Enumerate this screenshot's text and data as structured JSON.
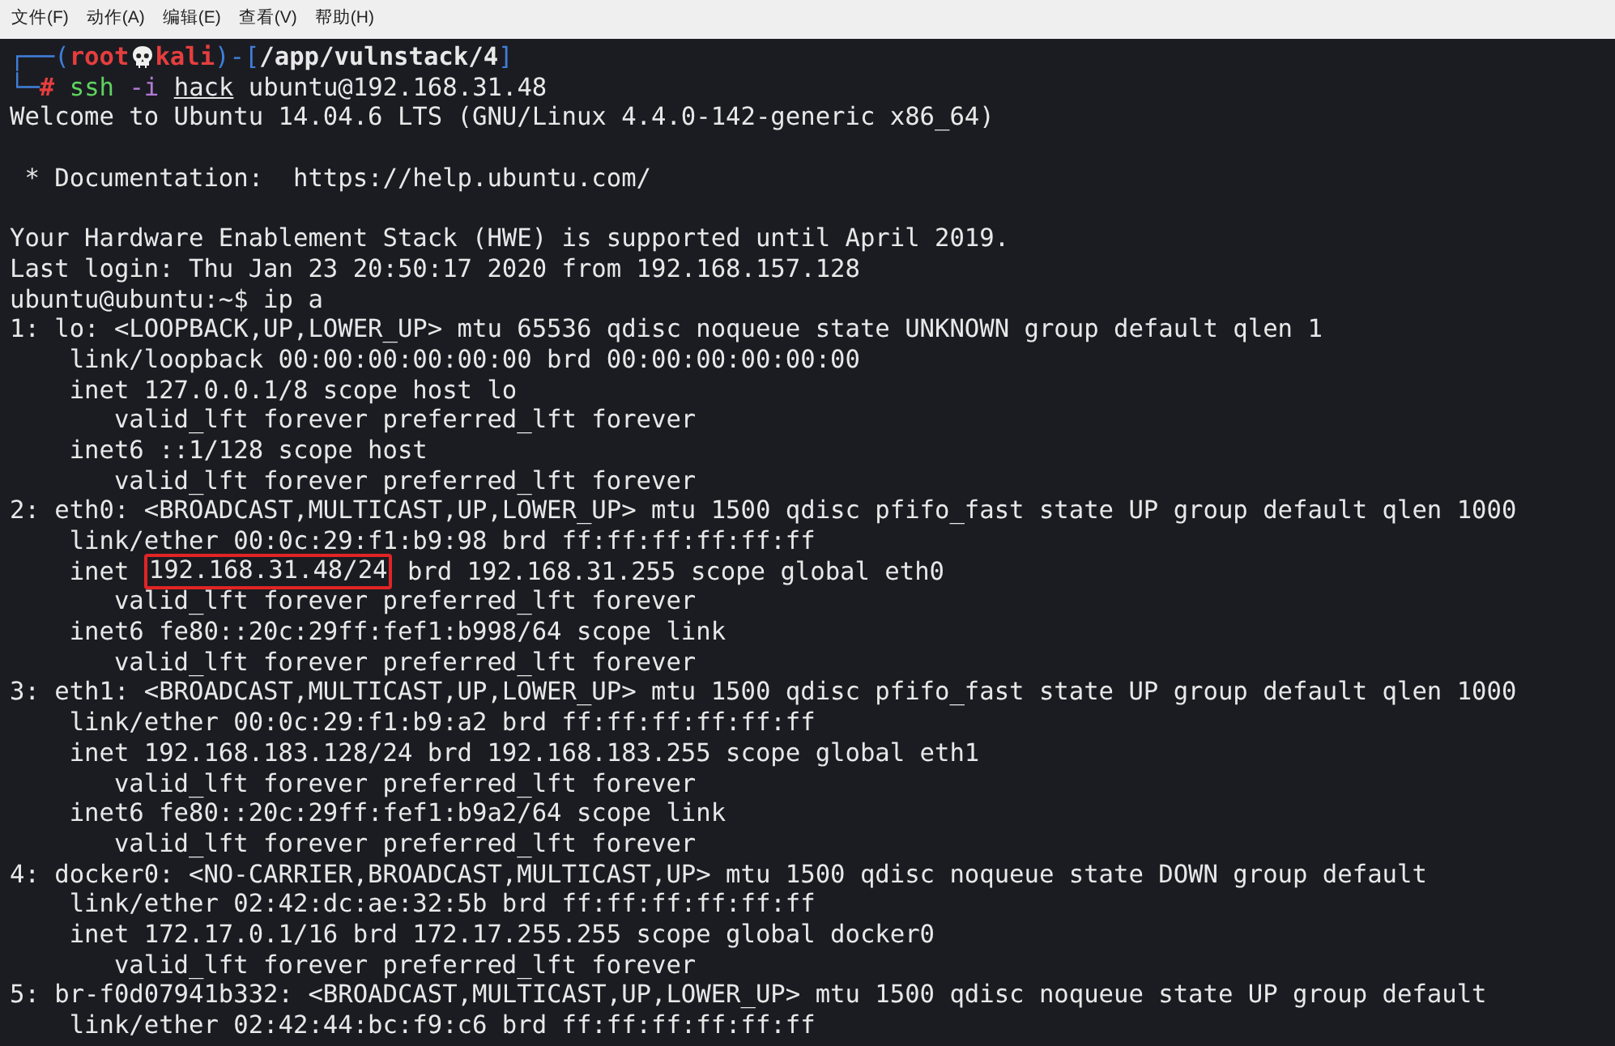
{
  "menu": [
    "文件(F)",
    "动作(A)",
    "编辑(E)",
    "查看(V)",
    "帮助(H)"
  ],
  "prompt": {
    "corner_top": "┌──(",
    "host_close": ")-[",
    "path_close": "]",
    "corner_bottom": "└─",
    "user": "root",
    "host": "kali",
    "path": "/app/vulnstack/4",
    "symbol": "#",
    "command": [
      {
        "text": "ssh",
        "kind": "command"
      },
      {
        "text": "-i",
        "kind": "option"
      },
      {
        "text": "hack",
        "kind": "file"
      },
      {
        "text": "ubuntu@192.168.31.48",
        "kind": "argument"
      }
    ]
  },
  "output": [
    {
      "kind": "plain",
      "text": "Welcome to Ubuntu 14.04.6 LTS (GNU/Linux 4.4.0-142-generic x86_64)"
    },
    {
      "kind": "blank"
    },
    {
      "kind": "plain",
      "text": " * Documentation:  https://help.ubuntu.com/"
    },
    {
      "kind": "blank"
    },
    {
      "kind": "plain",
      "text": "Your Hardware Enablement Stack (HWE) is supported until April 2019."
    },
    {
      "kind": "plain",
      "text": "Last login: Thu Jan 23 20:50:17 2020 from 192.168.157.128"
    },
    {
      "kind": "plain",
      "text": "ubuntu@ubuntu:~$ ip a"
    },
    {
      "kind": "plain",
      "text": "1: lo: <LOOPBACK,UP,LOWER_UP> mtu 65536 qdisc noqueue state UNKNOWN group default qlen 1"
    },
    {
      "kind": "plain",
      "text": "    link/loopback 00:00:00:00:00:00 brd 00:00:00:00:00:00"
    },
    {
      "kind": "plain",
      "text": "    inet 127.0.0.1/8 scope host lo"
    },
    {
      "kind": "plain",
      "text": "       valid_lft forever preferred_lft forever"
    },
    {
      "kind": "plain",
      "text": "    inet6 ::1/128 scope host"
    },
    {
      "kind": "plain",
      "text": "       valid_lft forever preferred_lft forever"
    },
    {
      "kind": "plain",
      "text": "2: eth0: <BROADCAST,MULTICAST,UP,LOWER_UP> mtu 1500 qdisc pfifo_fast state UP group default qlen 1000"
    },
    {
      "kind": "plain",
      "text": "    link/ether 00:0c:29:f1:b9:98 brd ff:ff:ff:ff:ff:ff"
    },
    {
      "kind": "boxed",
      "before": "    inet ",
      "boxed": "192.168.31.48/24",
      "after": " brd 192.168.31.255 scope global eth0"
    },
    {
      "kind": "plain",
      "text": "       valid_lft forever preferred_lft forever"
    },
    {
      "kind": "plain",
      "text": "    inet6 fe80::20c:29ff:fef1:b998/64 scope link"
    },
    {
      "kind": "plain",
      "text": "       valid_lft forever preferred_lft forever"
    },
    {
      "kind": "plain",
      "text": "3: eth1: <BROADCAST,MULTICAST,UP,LOWER_UP> mtu 1500 qdisc pfifo_fast state UP group default qlen 1000"
    },
    {
      "kind": "plain",
      "text": "    link/ether 00:0c:29:f1:b9:a2 brd ff:ff:ff:ff:ff:ff"
    },
    {
      "kind": "plain",
      "text": "    inet 192.168.183.128/24 brd 192.168.183.255 scope global eth1"
    },
    {
      "kind": "plain",
      "text": "       valid_lft forever preferred_lft forever"
    },
    {
      "kind": "plain",
      "text": "    inet6 fe80::20c:29ff:fef1:b9a2/64 scope link"
    },
    {
      "kind": "plain",
      "text": "       valid_lft forever preferred_lft forever"
    },
    {
      "kind": "plain",
      "text": "4: docker0: <NO-CARRIER,BROADCAST,MULTICAST,UP> mtu 1500 qdisc noqueue state DOWN group default"
    },
    {
      "kind": "plain",
      "text": "    link/ether 02:42:dc:ae:32:5b brd ff:ff:ff:ff:ff:ff"
    },
    {
      "kind": "plain",
      "text": "    inet 172.17.0.1/16 brd 172.17.255.255 scope global docker0"
    },
    {
      "kind": "plain",
      "text": "       valid_lft forever preferred_lft forever"
    },
    {
      "kind": "plain",
      "text": "5: br-f0d07941b332: <BROADCAST,MULTICAST,UP,LOWER_UP> mtu 1500 qdisc noqueue state UP group default"
    },
    {
      "kind": "plain",
      "text": "    link/ether 02:42:44:bc:f9:c6 brd ff:ff:ff:ff:ff:ff"
    }
  ]
}
